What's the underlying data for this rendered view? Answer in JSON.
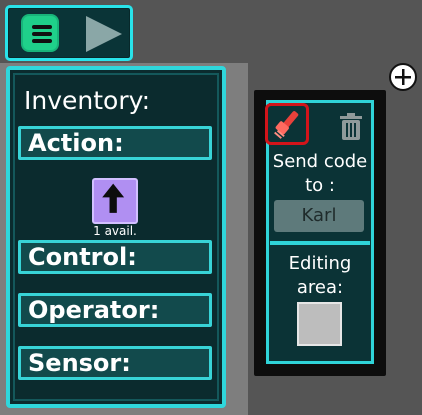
{
  "toolbar": {
    "menu_icon": "hamburger-menu-icon",
    "play_icon": "play-icon"
  },
  "inventory": {
    "title": "Inventory:",
    "categories": [
      {
        "label": "Action:"
      },
      {
        "label": "Control:"
      },
      {
        "label": "Operator:"
      },
      {
        "label": "Sensor:"
      }
    ],
    "action_block": {
      "icon": "up-arrow-icon",
      "availability": "1 avail."
    }
  },
  "send_panel": {
    "brush_icon": "paintbrush-icon",
    "trash_icon": "trash-icon",
    "send_label": "Send code to :",
    "target": "Karl",
    "editing_label": "Editing area:"
  },
  "add_button": {
    "icon": "plus-icon"
  },
  "colors": {
    "accent_cyan": "#2fd7dc",
    "menu_green": "#1fd08a",
    "block_purple": "#b08ff2",
    "brush_red": "#d2141a"
  }
}
